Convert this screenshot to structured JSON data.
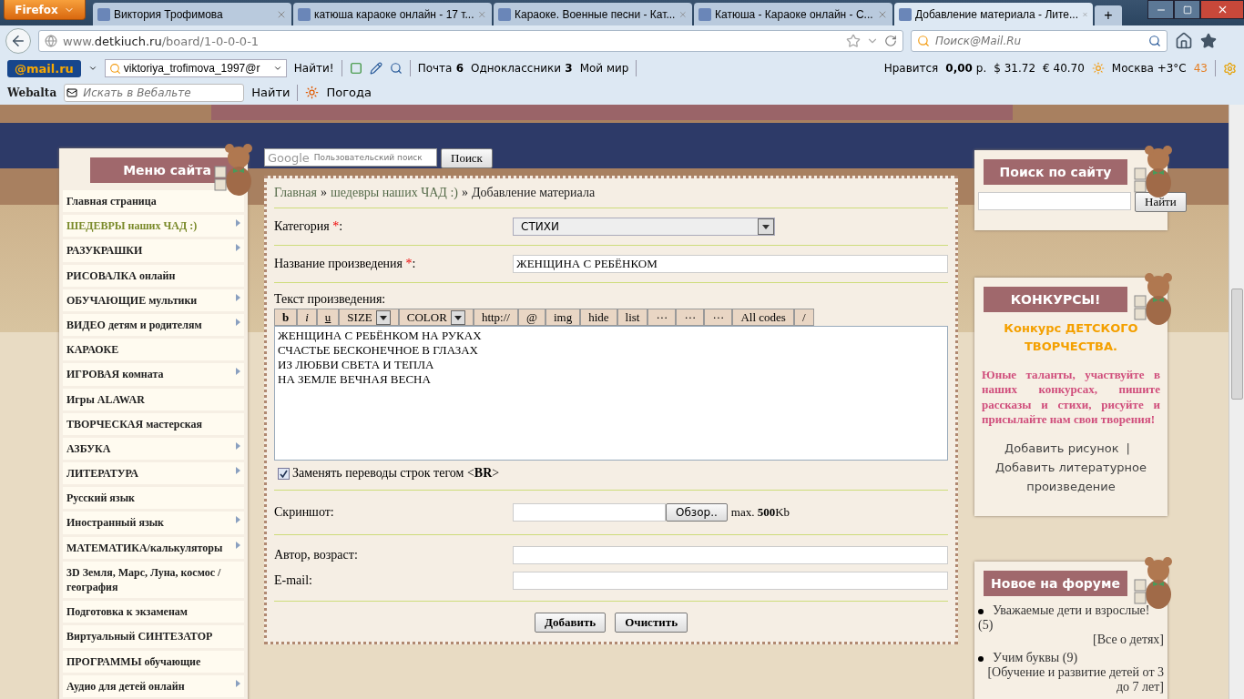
{
  "browser": {
    "app_button": "Firefox",
    "tabs": [
      {
        "title": "Виктория Трофимова",
        "selected": false
      },
      {
        "title": "катюша караоке онлайн - 17 т...",
        "selected": false
      },
      {
        "title": "Караоке. Военные песни - Кат...",
        "selected": false
      },
      {
        "title": "Катюша - Караоке онлайн - С...",
        "selected": false
      },
      {
        "title": "Добавление материала - Лите...",
        "selected": true
      }
    ],
    "new_tab": "+",
    "url_host": "www.",
    "url_domain": "detkiuch.ru",
    "url_path": "/board/1-0-0-0-1",
    "search_placeholder": "Поиск@Mail.Ru"
  },
  "mail_toolbar": {
    "logo": "@mail.ru",
    "account": "viktoriya_trofimova_1997@r",
    "find": "Найти!",
    "links": [
      {
        "label": "Почта",
        "count": "6"
      },
      {
        "label": "Одноклассники",
        "count": "3"
      },
      {
        "label": "Мой мир"
      }
    ],
    "likes": "Нравится",
    "balance": "0,00",
    "currency": "р.",
    "usd_sign": "$",
    "usd": "31.72",
    "eur_sign": "€",
    "eur": "40.70",
    "weather": "Москва +3°C",
    "traffic": "43"
  },
  "webalta_toolbar": {
    "logo": "Webalta",
    "placeholder": "Искать в Вебальте",
    "find": "Найти",
    "weather": "Погода"
  },
  "google_search": {
    "logo": "Google",
    "placeholder": "Пользовательский поиск",
    "button": "Поиск"
  },
  "menu": {
    "title": "Меню сайта",
    "items": [
      {
        "label": "Главная страница",
        "submenu": false,
        "selected": false
      },
      {
        "label": "ШЕДЕВРЫ наших ЧАД :)",
        "submenu": true,
        "selected": true
      },
      {
        "label": "РАЗУКРАШКИ",
        "submenu": true,
        "selected": false
      },
      {
        "label": "РИСОВАЛКА онлайн",
        "submenu": false,
        "selected": false
      },
      {
        "label": "ОБУЧАЮЩИЕ мультики",
        "submenu": true,
        "selected": false
      },
      {
        "label": "ВИДЕО детям и родителям",
        "submenu": true,
        "selected": false
      },
      {
        "label": "КАРАОКЕ",
        "submenu": false,
        "selected": false
      },
      {
        "label": "ИГРОВАЯ комната",
        "submenu": true,
        "selected": false
      },
      {
        "label": "Игры ALAWAR",
        "submenu": false,
        "selected": false
      },
      {
        "label": "ТВОРЧЕСКАЯ мастерская",
        "submenu": false,
        "selected": false
      },
      {
        "label": "АЗБУКА",
        "submenu": true,
        "selected": false
      },
      {
        "label": "ЛИТЕРАТУРА",
        "submenu": true,
        "selected": false
      },
      {
        "label": "Русский язык",
        "submenu": false,
        "selected": false
      },
      {
        "label": "Иностранный язык",
        "submenu": true,
        "selected": false
      },
      {
        "label": "МАТЕМАТИКА/калькуляторы",
        "submenu": true,
        "selected": false
      },
      {
        "label": "3D Земля, Марс, Луна, космос / география",
        "submenu": false,
        "selected": false
      },
      {
        "label": "Подготовка к экзаменам",
        "submenu": false,
        "selected": false
      },
      {
        "label": "Виртуальный СИНТЕЗАТОР",
        "submenu": false,
        "selected": false
      },
      {
        "label": "ПРОГРАММЫ обучающие",
        "submenu": false,
        "selected": false
      },
      {
        "label": "Аудио для детей онлайн",
        "submenu": true,
        "selected": false
      }
    ]
  },
  "breadcrumbs": [
    {
      "label": "Главная",
      "kind": "link"
    },
    {
      "label": "»",
      "kind": "sep"
    },
    {
      "label": "шедевры наших ЧАД :)",
      "kind": "link"
    },
    {
      "label": "»",
      "kind": "sep"
    },
    {
      "label": "Добавление материала",
      "kind": "current"
    }
  ],
  "form": {
    "category": {
      "label": "Категория",
      "required": true,
      "required_mark": "*",
      "suffix": ":",
      "value": "СТИХИ"
    },
    "title": {
      "label": "Название произведения",
      "required": true,
      "required_mark": "*",
      "suffix": ":",
      "value": "ЖЕНЩИНА С РЕБЁНКОМ"
    },
    "text_label": "Текст произведения:",
    "toolbar": [
      {
        "label": "b",
        "kind": "bold"
      },
      {
        "label": "i",
        "kind": "italic"
      },
      {
        "label": "u",
        "kind": "underline"
      },
      {
        "label": "SIZE",
        "kind": "select"
      },
      {
        "label": "COLOR",
        "kind": "select"
      },
      {
        "label": "http://",
        "kind": "plain"
      },
      {
        "label": "@",
        "kind": "plain"
      },
      {
        "label": "img",
        "kind": "plain"
      },
      {
        "label": "hide",
        "kind": "plain"
      },
      {
        "label": "list",
        "kind": "plain"
      },
      {
        "label": "···",
        "kind": "plain"
      },
      {
        "label": "···",
        "kind": "plain"
      },
      {
        "label": "···",
        "kind": "plain"
      },
      {
        "label": "All codes",
        "kind": "plain"
      },
      {
        "label": "/",
        "kind": "plain"
      }
    ],
    "text_value": "ЖЕНЩИНА С РЕБЁНКОМ НА РУКАХ\nСЧАСТЬЕ БЕСКОНЕЧНОЕ В ГЛАЗАХ\nИЗ ЛЮБВИ СВЕТА И ТЕПЛА\nНА ЗЕМЛЕ ВЕЧНАЯ ВЕСНА ",
    "replace_br": {
      "label": "Заменять переводы строк тегом <**BR**>",
      "checked": true
    },
    "screenshot": {
      "label": "Скриншот:",
      "browse": "Обзор..",
      "limit": "max. **500**Kb"
    },
    "author_label": "Автор, возраст:",
    "email_label": "E-mail:",
    "buttons": [
      "Добавить",
      "Очистить"
    ]
  },
  "site_search": {
    "title": "Поиск по сайту",
    "button": "Найти"
  },
  "contests": {
    "title": "КОНКУРСЫ!",
    "heading": "Конкурс ДЕТСКОГО ТВОРЧЕСТВА.",
    "text": "Юные таланты, участвуйте в наших конкурсах, пишите рассказы и стихи, рисуйте и присылайте нам свои творения!",
    "link_drawing": "Добавить рисунок",
    "separator": "|",
    "link_literature": "Добавить литературное произведение"
  },
  "forum": {
    "title": "Новое на форуме",
    "topics": [
      {
        "title": "Уважаемые дети и взрослые!",
        "count": "(5)",
        "section": "[Все о детях]"
      },
      {
        "title": "Учим буквы",
        "count": "(9)",
        "section": "[Обучение и развитие детей от 3 до 7 лет]"
      }
    ]
  }
}
